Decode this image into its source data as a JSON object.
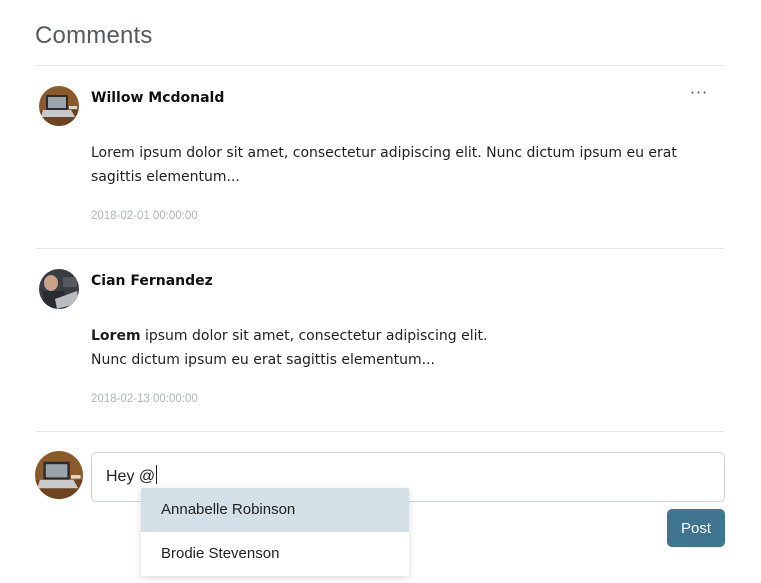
{
  "page": {
    "title": "Comments"
  },
  "comments": [
    {
      "author": "Willow Mcdonald",
      "body_lines": [
        "Lorem ipsum dolor sit amet, consectetur adipiscing elit. Nunc dictum ipsum eu erat",
        "sagittis elementum..."
      ],
      "timestamp": "2018-02-01 00:00:00",
      "menu_label": "···"
    },
    {
      "author": "Cian Fernandez",
      "body_bold": "Lorem",
      "body_rest": " ipsum dolor sit amet, consectetur adipiscing elit.",
      "body_line2": "Nunc dictum ipsum eu erat sagittis elementum...",
      "timestamp": "2018-02-13 00:00:00"
    }
  ],
  "composer": {
    "value": "Hey @",
    "post_label": "Post",
    "suggestions": [
      "Annabelle Robinson",
      "Brodie Stevenson"
    ]
  },
  "colors": {
    "accent": "#3f758f",
    "suggestion_highlight": "#d3e0e8"
  }
}
